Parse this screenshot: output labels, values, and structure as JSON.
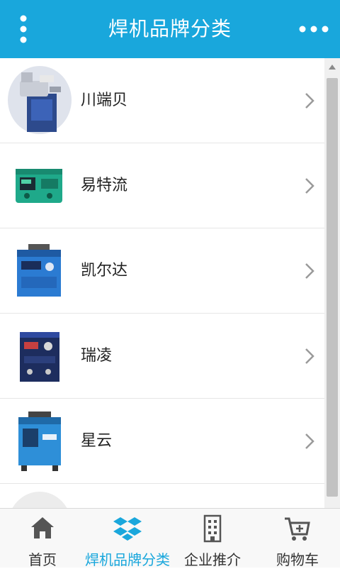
{
  "header": {
    "title": "焊机品牌分类",
    "menu_icon": "vertical-dots-icon",
    "more_icon": "horizontal-dots-icon"
  },
  "brands": [
    {
      "label": "川端贝"
    },
    {
      "label": "易特流"
    },
    {
      "label": "凯尔达"
    },
    {
      "label": "瑞凌"
    },
    {
      "label": "星云"
    }
  ],
  "tabs": [
    {
      "label": "首页",
      "icon": "home-icon"
    },
    {
      "label": "焊机品牌分类",
      "icon": "dropbox-icon"
    },
    {
      "label": "企业推介",
      "icon": "building-icon"
    },
    {
      "label": "购物车",
      "icon": "cart-icon"
    }
  ],
  "colors": {
    "accent": "#19a7dc",
    "active_tab": "#1aa7dc"
  },
  "scroll": {
    "position_fraction": 0
  }
}
